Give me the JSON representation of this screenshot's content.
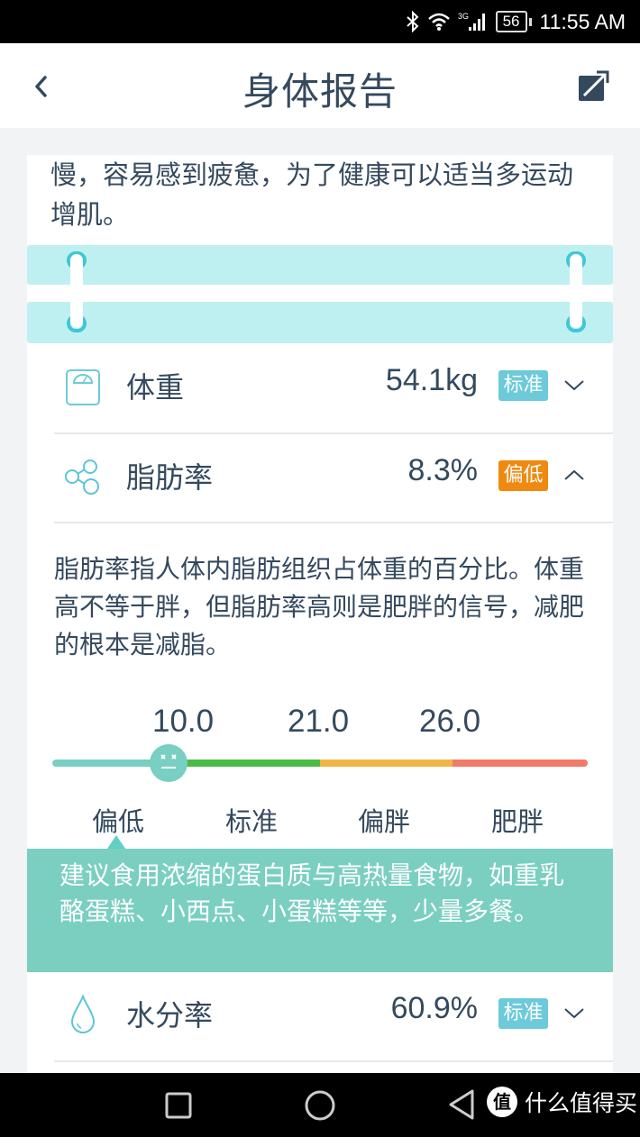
{
  "status_bar": {
    "network": "3G",
    "battery": "56",
    "time": "11:55 AM",
    "icons": [
      "bluetooth-icon",
      "wifi-icon",
      "cellular-signal-icon",
      "battery-icon"
    ]
  },
  "header": {
    "title": "身体报告",
    "back_icon": "chevron-left-icon",
    "share_icon": "share-external-icon"
  },
  "intro_text": "慢，容易感到疲惫，为了健康可以适当多运动增肌。",
  "metrics": [
    {
      "icon": "scale-icon",
      "label": "体重",
      "value": "54.1kg",
      "badge": "标准",
      "badge_color": "#6ccad9",
      "expanded": false
    },
    {
      "icon": "molecule-icon",
      "label": "脂肪率",
      "value": "8.3%",
      "badge": "偏低",
      "badge_color": "#f0890f",
      "expanded": true
    },
    {
      "icon": "water-drop-icon",
      "label": "水分率",
      "value": "60.9%",
      "badge": "标准",
      "badge_color": "#6ccad9",
      "expanded": false
    }
  ],
  "fat_detail": {
    "description": "脂肪率指人体内脂肪组织占体重的百分比。体重高不等于胖，但脂肪率高则是肥胖的信号，减肥的根本是减脂。",
    "thresholds": [
      "10.0",
      "21.0",
      "26.0"
    ],
    "categories": [
      {
        "label": "偏低",
        "color": "#78cfc2"
      },
      {
        "label": "标准",
        "color": "#4cbb45"
      },
      {
        "label": "偏胖",
        "color": "#f0b545"
      },
      {
        "label": "肥胖",
        "color": "#f27a68"
      }
    ],
    "current_value": 8.3,
    "current_category": "偏低",
    "advice": "建议食用浓缩的蛋白质与高热量食物，如重乳酪蛋糕、小西点、小蛋糕等等，少量多餐。"
  },
  "system_nav": {
    "buttons": [
      "recent-apps",
      "home",
      "back"
    ],
    "watermark": "什么值得买",
    "watermark_logo": "值"
  }
}
